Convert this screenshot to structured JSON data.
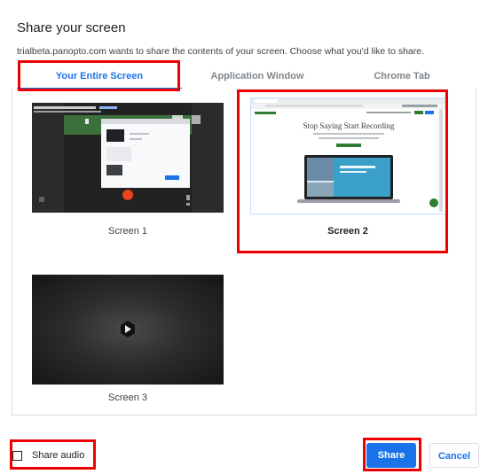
{
  "dialog": {
    "title": "Share your screen",
    "subtitle": "trialbeta.panopto.com wants to share the contents of your screen. Choose what you'd like to share."
  },
  "tabs": [
    {
      "label": "Your Entire Screen",
      "active": true
    },
    {
      "label": "Application Window",
      "active": false
    },
    {
      "label": "Chrome Tab",
      "active": false
    }
  ],
  "screens": [
    {
      "label": "Screen 1",
      "selected": false
    },
    {
      "label": "Screen 2",
      "selected": true
    },
    {
      "label": "Screen 3",
      "selected": false
    }
  ],
  "footer": {
    "share_audio_label": "Share audio",
    "share_audio_checked": false,
    "share_label": "Share",
    "cancel_label": "Cancel"
  },
  "preview2": {
    "headline": "Stop Saying Start Recording"
  },
  "colors": {
    "accent": "#1a73e8",
    "highlight_box": "#ee0000",
    "record_dot": "#e8431c"
  }
}
